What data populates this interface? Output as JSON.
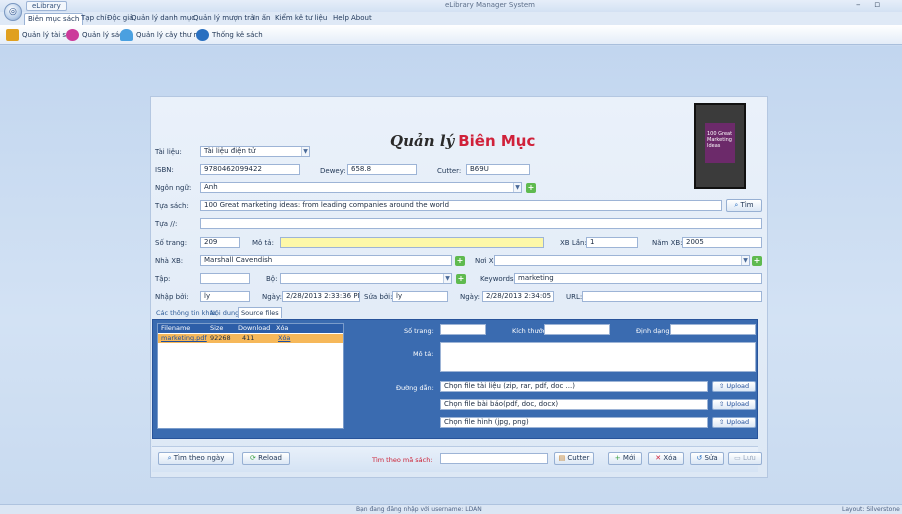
{
  "window": {
    "app_menu_label": "eLibrary",
    "title": "eLibrary Manager System",
    "minimize": "–",
    "maximize": "▫"
  },
  "ribbon_tabs": [
    "Biên mục sách",
    "Tạp chí",
    "Độc giả",
    "Quản lý danh mục",
    "Quản lý mượn trả",
    "In ấn",
    "Kiểm kê tư liệu",
    "Help",
    "About"
  ],
  "toolbar": {
    "items": [
      "Quản lý tài sản",
      "Quản lý sách",
      "Quản lý cây thư mục",
      "Thống kê sách"
    ],
    "icon_colors": [
      "#e0a020",
      "#cc3a9a",
      "#4aa0e0",
      "#2a70c0"
    ]
  },
  "form": {
    "title_word1": "Quản lý",
    "title_word2": "Biên Mục",
    "tai_lieu_label": "Tài liệu:",
    "tai_lieu_value": "Tài liệu điện tử",
    "isbn_label": "ISBN:",
    "isbn_value": "9780462099422",
    "dewey_label": "Dewey:",
    "dewey_value": "658.8",
    "cutter_label": "Cutter:",
    "cutter_value": "B69U",
    "ngon_ngu_label": "Ngôn ngữ:",
    "ngon_ngu_value": "Anh",
    "tua_sach_label": "Tựa sách:",
    "tua_sach_value": "100 Great marketing ideas: from leading companies around the world",
    "tim_button": "Tìm",
    "tua_p_label": "Tựa //:",
    "tua_p_value": "",
    "so_trang_label": "Số trang:",
    "so_trang_value": "209",
    "mo_ta_label": "Mô tả:",
    "mo_ta_value": "",
    "xb_lan_label": "XB Lần:",
    "xb_lan_value": "1",
    "nam_xb_label": "Năm XB:",
    "nam_xb_value": "2005",
    "nha_xb_label": "Nhà XB:",
    "nha_xb_value": "Marshall Cavendish",
    "noi_xb_label": "Nơi XB:",
    "noi_xb_value": "",
    "tap_label": "Tập:",
    "tap_value": "",
    "bo_label": "Bộ:",
    "bo_value": "",
    "keywords_label": "Keywords:",
    "keywords_value": "marketing",
    "nhap_boi_label": "Nhập bởi:",
    "nhap_boi_value": "ly",
    "ngay1_label": "Ngày:",
    "ngay1_value": "2/28/2013 2:33:36 PM",
    "sua_boi_label": "Sửa bởi:",
    "sua_boi_value": "ly",
    "ngay2_label": "Ngày:",
    "ngay2_value": "2/28/2013 2:34:05 P",
    "url_label": "URL:",
    "url_value": ""
  },
  "cover": {
    "text": "100 Great Marketing Ideas"
  },
  "subtabs": [
    "Các thông tin khác",
    "Nội dung",
    "Source files"
  ],
  "files": {
    "columns": [
      "Filename",
      "Size",
      "Download",
      "Xóa"
    ],
    "rows": [
      {
        "filename": "marketing.pdf",
        "size": "92268",
        "download": "411",
        "delete": "Xóa"
      }
    ],
    "so_trang_label": "Số trang:",
    "kich_thuoc_label": "Kích thước:",
    "dinh_dang_label": "Định dạng:",
    "mo_ta_label": "Mô tả:",
    "duong_dan_label": "Đường dẫn:",
    "path_rows": [
      "Chọn file tài liệu (zip, rar, pdf, doc ...)",
      "Chọn file bài báo(pdf, doc, docx)",
      "Chọn file hình (jpg, png)"
    ],
    "upload_label": "Upload"
  },
  "bottom": {
    "tim_theo_ngay": "Tìm theo ngày",
    "reload": "Reload",
    "tim_ma_sach_label": "Tìm theo mã sách:",
    "tim_ma_sach_value": "",
    "cutter_btn": "Cutter",
    "moi_btn": "Mới",
    "xoa_btn": "Xóa",
    "sua_btn": "Sửa",
    "luu_btn": "Lưu"
  },
  "status": {
    "left": "Bạn đang đăng nhập với username: LDAN",
    "right": "Layout: Silverstone"
  }
}
